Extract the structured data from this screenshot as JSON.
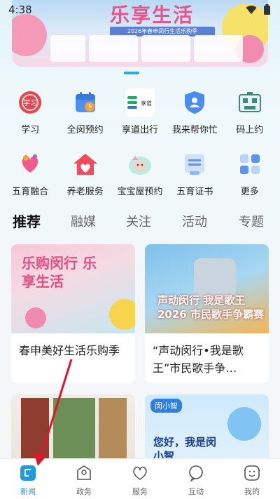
{
  "status": {
    "time": "4:38"
  },
  "banner": {
    "title": "乐享生活",
    "subtitle": "2026年春申闵行生活乐购季"
  },
  "grid": {
    "row1": [
      {
        "label": "学习",
        "icon": "study-icon"
      },
      {
        "label": "全闵预约",
        "icon": "calendar-icon"
      },
      {
        "label": "享道出行",
        "icon": "ride-icon"
      },
      {
        "label": "我来帮你忙",
        "icon": "help-shield-icon"
      },
      {
        "label": "码上约",
        "icon": "qr-booking-icon"
      }
    ],
    "row2": [
      {
        "label": "五育融合",
        "icon": "education-icon"
      },
      {
        "label": "养老服务",
        "icon": "elderly-house-icon"
      },
      {
        "label": "宝宝屋预约",
        "icon": "baby-icon"
      },
      {
        "label": "五育证书",
        "icon": "certificate-icon"
      },
      {
        "label": "更多",
        "icon": "more-grid-icon"
      }
    ]
  },
  "ride_logo_text": "享道",
  "tabs": [
    "推荐",
    "融媒",
    "关注",
    "活动",
    "专题"
  ],
  "cards": [
    {
      "title": "春申美好生活乐购季",
      "image_text": "乐购闵行 乐享生活"
    },
    {
      "title": "“声动闵行•我是歌王”市民歌手争…",
      "image_text": "声动闵行 我是歌王 2026 市民歌手争霸赛"
    },
    {
      "title": "",
      "image_text": ""
    },
    {
      "title": "",
      "image_text": "您好，我是闵小智",
      "badge": "闵小智"
    }
  ],
  "tabbar": [
    {
      "label": "新闻",
      "icon": "news-icon",
      "active": true
    },
    {
      "label": "政务",
      "icon": "government-icon",
      "active": false
    },
    {
      "label": "服务",
      "icon": "service-heart-icon",
      "active": false
    },
    {
      "label": "互动",
      "icon": "interaction-icon",
      "active": false
    },
    {
      "label": "我的",
      "icon": "profile-icon",
      "active": false
    }
  ],
  "colors": {
    "accent": "#1e9be0",
    "pink": "#e8558d",
    "arrow": "#e0162b"
  }
}
